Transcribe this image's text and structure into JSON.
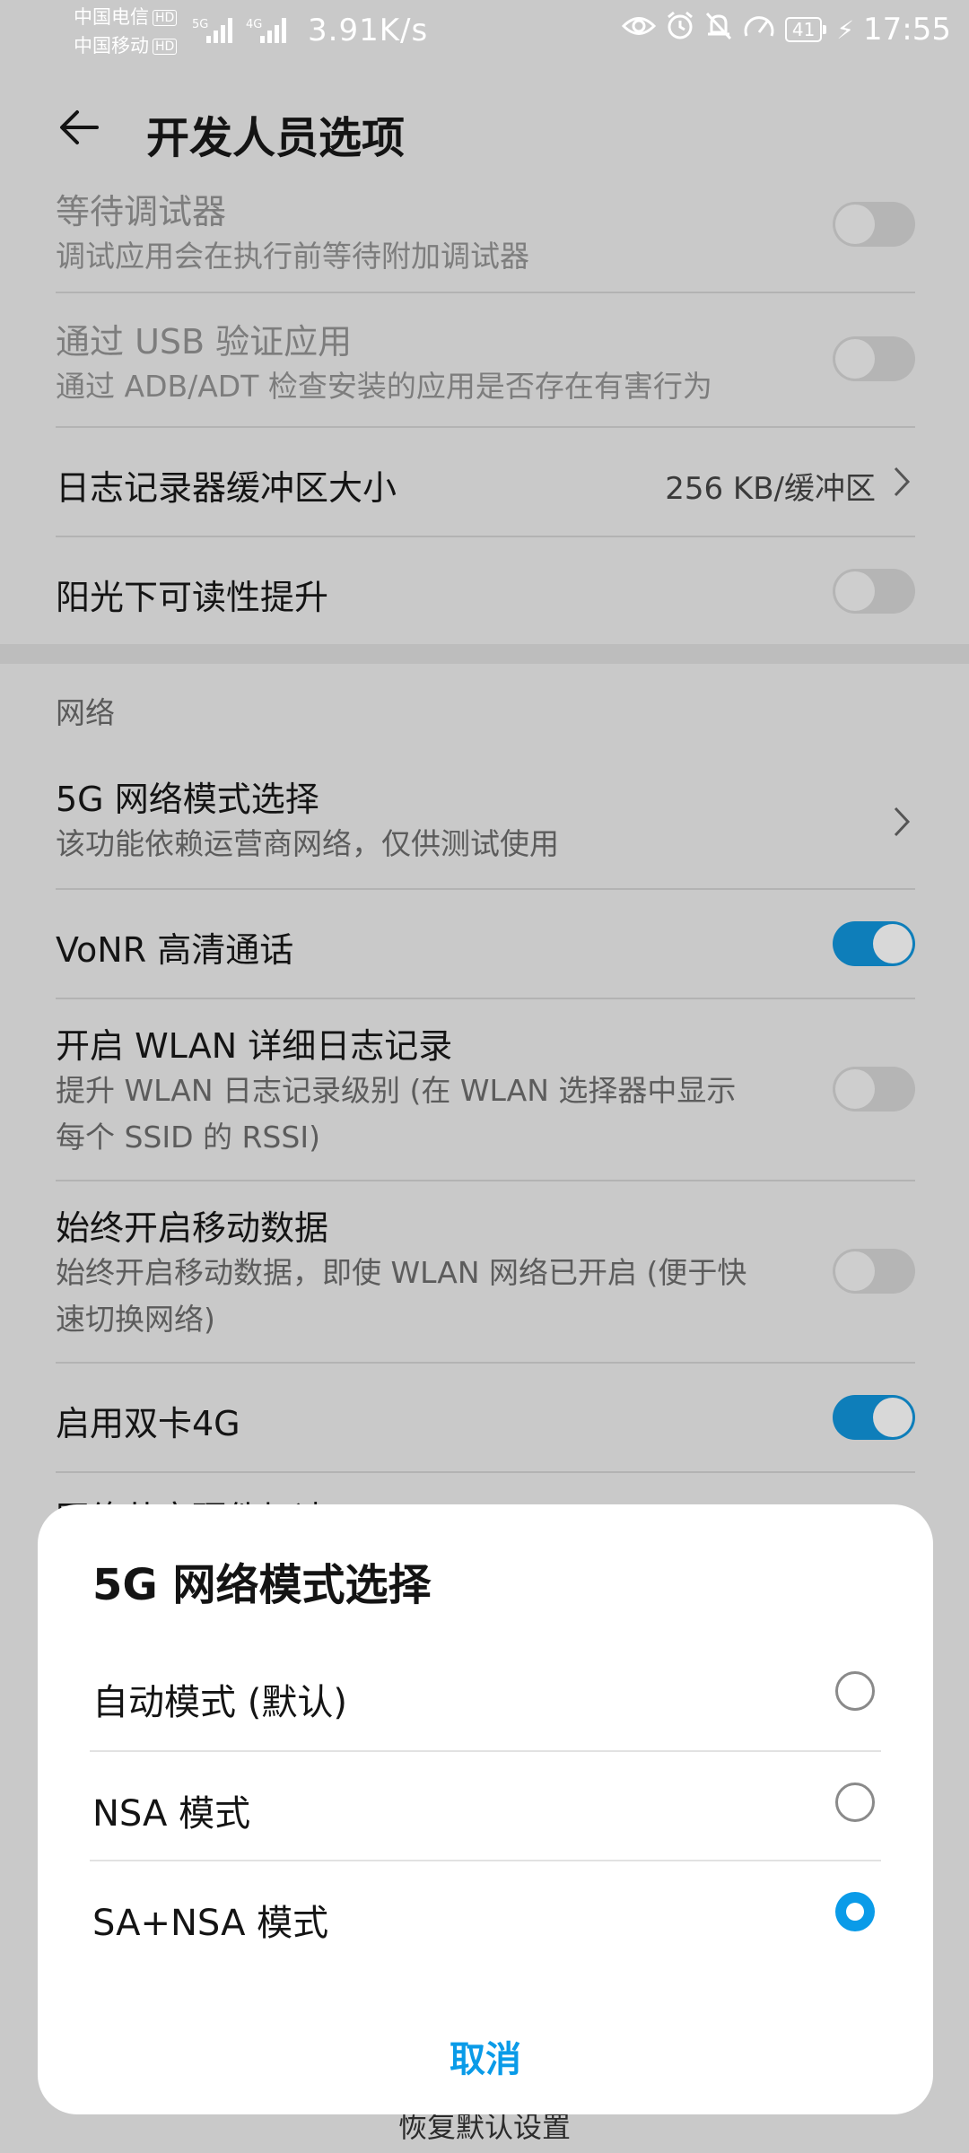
{
  "status_bar": {
    "carrier1": "中国电信",
    "carrier2": "中国移动",
    "hd": "HD",
    "net1": "5G",
    "net2": "4G",
    "speed": "3.91K/s",
    "icons": [
      "eye-icon",
      "alarm-icon",
      "mute-bell-icon",
      "speed-gauge-icon"
    ],
    "battery": "41",
    "time": "17:55"
  },
  "header": {
    "title": "开发人员选项"
  },
  "settings": {
    "wait_debugger": {
      "title": "等待调试器",
      "subtitle": "调试应用会在执行前等待附加调试器",
      "enabled": false,
      "on": false
    },
    "verify_usb": {
      "title": "通过 USB 验证应用",
      "subtitle": "通过 ADB/ADT 检查安装的应用是否存在有害行为",
      "enabled": false,
      "on": false
    },
    "log_buffer": {
      "title": "日志记录器缓冲区大小",
      "value": "256 KB/缓冲区"
    },
    "sunlight": {
      "title": "阳光下可读性提升",
      "on": false
    },
    "network_section": "网络",
    "nr_mode": {
      "title": "5G 网络模式选择",
      "subtitle": "该功能依赖运营商网络，仅供测试使用"
    },
    "vonr": {
      "title": "VoNR 高清通话",
      "on": true
    },
    "wlan_log": {
      "title": "开启 WLAN 详细日志记录",
      "subtitle_line1": "提升 WLAN 日志记录级别 (在 WLAN 选择器中显示",
      "subtitle_line2": "每个 SSID 的 RSSI)",
      "on": false
    },
    "mobile_data": {
      "title": "始终开启移动数据",
      "subtitle_line1": "始终开启移动数据，即使 WLAN 网络已开启 (便于快",
      "subtitle_line2": "速切换网络)",
      "on": false
    },
    "dual_4g": {
      "title": "启用双卡4G",
      "on": true
    },
    "hidden_row": {
      "title": "网络共享硬件加速"
    }
  },
  "dialog": {
    "title": "5G 网络模式选择",
    "options": [
      {
        "label": "自动模式 (默认)",
        "selected": false
      },
      {
        "label": "NSA 模式",
        "selected": false
      },
      {
        "label": "SA+NSA 模式",
        "selected": true
      }
    ],
    "cancel": "取消"
  },
  "footer": {
    "restore": "恢复默认设置"
  },
  "colors": {
    "accent": "#0a9be8",
    "switch_on": "#0e7eba",
    "scrim": "#c9c9c9"
  }
}
